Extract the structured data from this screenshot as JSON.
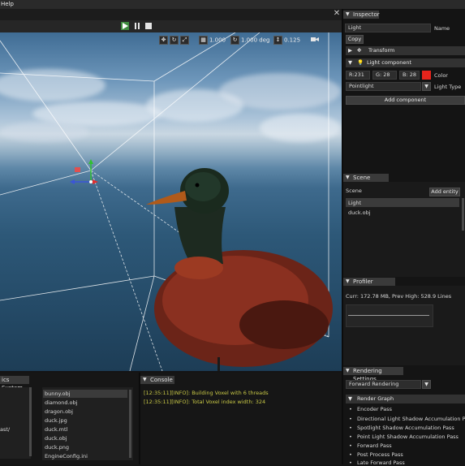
{
  "menubar": {
    "help_label": "Help"
  },
  "toolbar": {
    "play_icon": "play-icon",
    "pause_icon": "pause-icon",
    "stop_icon": "stop-icon",
    "close_icon": "close-icon"
  },
  "viewport": {
    "scale_value": "1.000",
    "rotate_value": "1.000 deg",
    "speed_value": "0.125"
  },
  "inspector": {
    "title": "Inspector",
    "name_value": "Light",
    "name_label": "Name",
    "copy_button": "Copy",
    "transform_label": "Transform",
    "light_component_label": "Light component",
    "color_r": "R:231",
    "color_g": "G: 28",
    "color_b": "B: 28",
    "color_label": "Color",
    "color_swatch": "#e7241c",
    "light_type_value": "Pointlight",
    "light_type_label": "Light Type",
    "add_component_button": "Add component"
  },
  "scene_graph": {
    "title": "Scene Graph",
    "scene_label": "Scene",
    "add_entity_button": "Add entity",
    "items": [
      "Light",
      "duck.obj"
    ]
  },
  "profiler": {
    "title": "Profiler Window",
    "summary": "Curr: 172.78 MB, Prev High: 528.9 Lines"
  },
  "rendering_settings": {
    "title": "Rendering Settings",
    "mode_value": "Forward Rendering",
    "render_graph_label": "Render Graph",
    "passes": [
      "Encoder Pass",
      "Directional Light Shadow Accumulation Pass",
      "Spotlight Shadow Accumulation Pass",
      "Point Light Shadow Accumulation Pass",
      "Forward Pass",
      "Post Process Pass",
      "Late Forward Pass"
    ]
  },
  "file_system": {
    "title": "ics System",
    "left_partial": "ast/",
    "files": [
      "bunny.obj",
      "diamond.obj",
      "dragon.obj",
      "duck.jpg",
      "duck.mtl",
      "duck.obj",
      "duck.png",
      "EngineConfig.ini"
    ]
  },
  "console": {
    "title": "Console",
    "lines": [
      "[12:35:11][INFO]: Building Voxel with 6 threads",
      "[12:35:11][INFO]: Total Voxel index width: 324"
    ]
  }
}
